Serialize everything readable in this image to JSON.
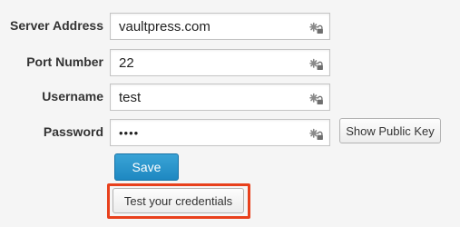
{
  "form": {
    "server_address": {
      "label": "Server Address",
      "value": "vaultpress.com"
    },
    "port_number": {
      "label": "Port Number",
      "value": "22"
    },
    "username": {
      "label": "Username",
      "value": "test"
    },
    "password": {
      "label": "Password",
      "value": "test"
    }
  },
  "field_icon": "key-lock-icon",
  "buttons": {
    "show_public_key": "Show Public Key",
    "save": "Save",
    "test_credentials": "Test your credentials"
  },
  "colors": {
    "save_button": "#2a93cb",
    "highlight": "#e8401c"
  }
}
